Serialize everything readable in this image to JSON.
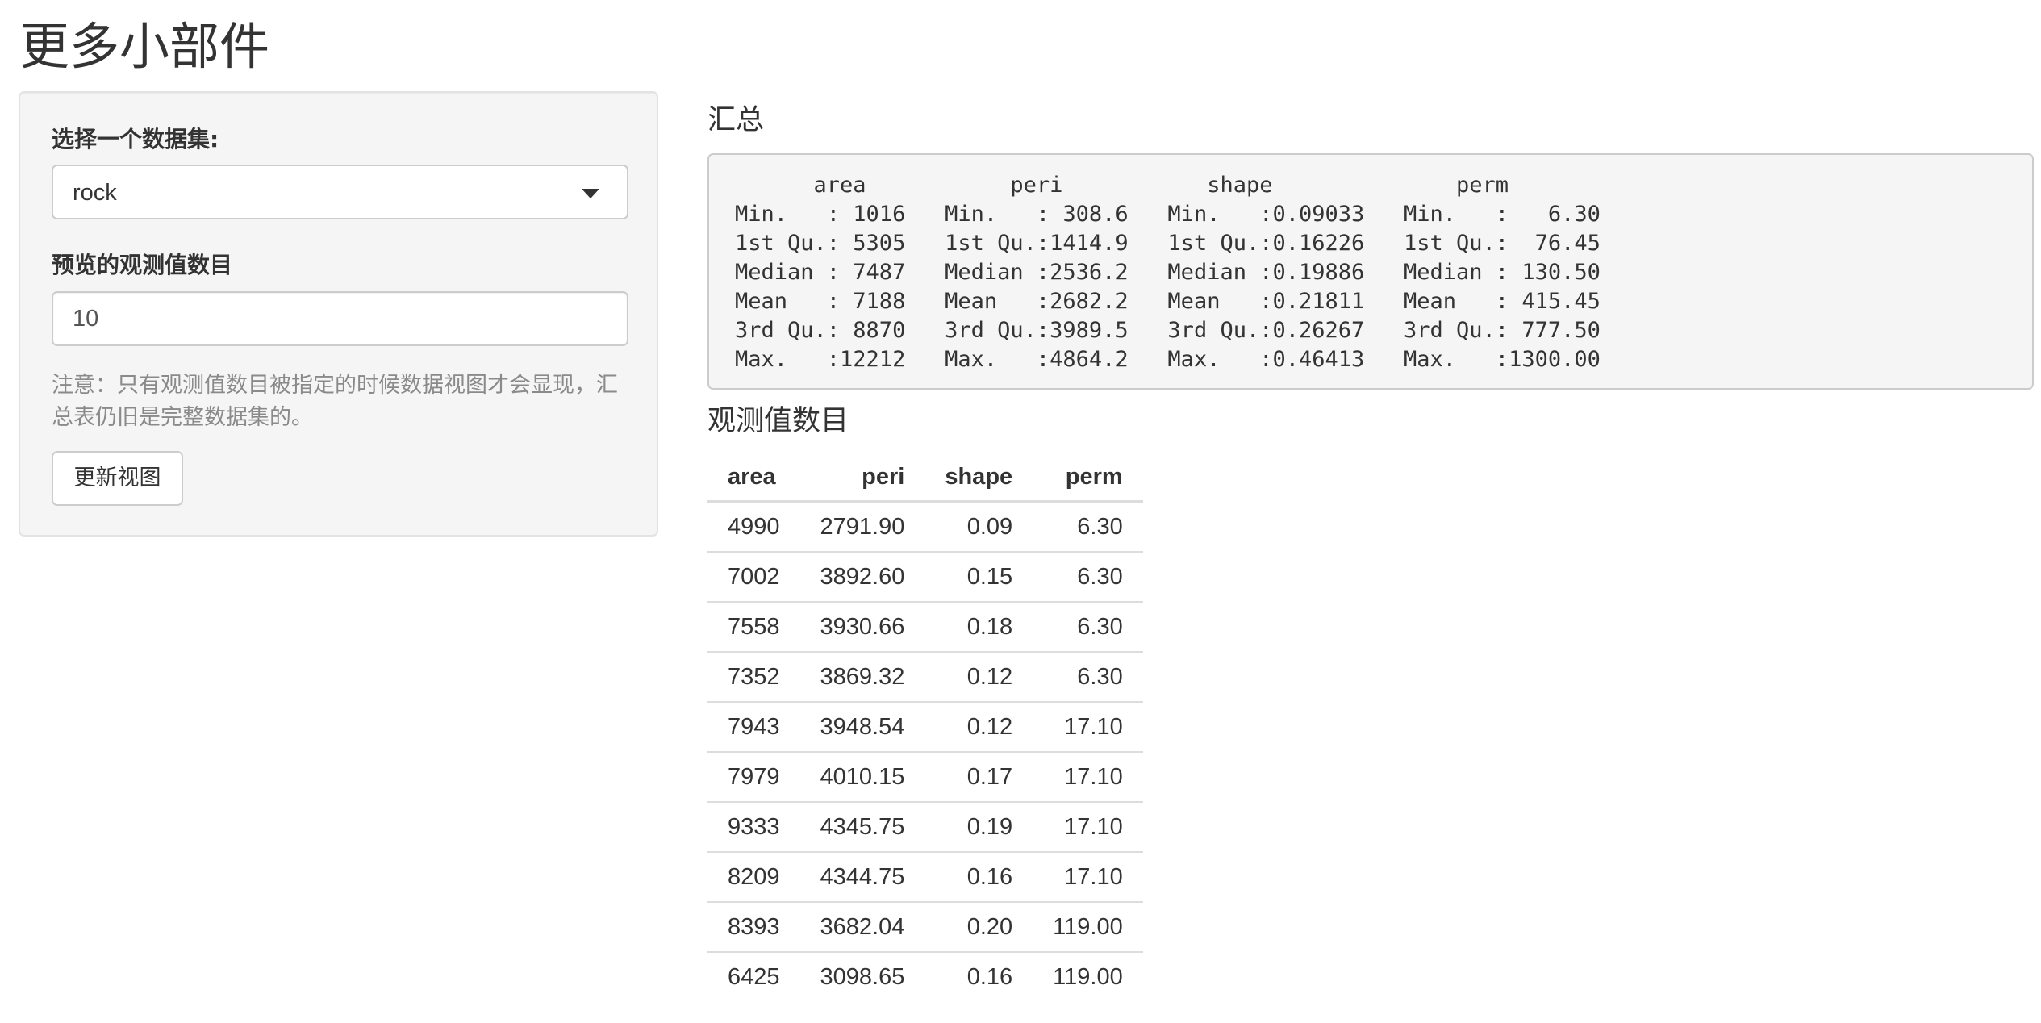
{
  "page": {
    "title": "更多小部件"
  },
  "sidebar": {
    "dataset_label": "选择一个数据集:",
    "dataset_value": "rock",
    "obs_label": "预览的观测值数目",
    "obs_value": "10",
    "help_text": "注意：只有观测值数目被指定的时候数据视图才会显现，汇总表仍旧是完整数据集的。",
    "update_button": "更新视图"
  },
  "summary": {
    "heading": "汇总",
    "lines": [
      "      area           peri           shape              perm       ",
      "Min.   : 1016   Min.   : 308.6   Min.   :0.09033   Min.   :   6.30  ",
      "1st Qu.: 5305   1st Qu.:1414.9   1st Qu.:0.16226   1st Qu.:  76.45  ",
      "Median : 7487   Median :2536.2   Median :0.19886   Median : 130.50  ",
      "Mean   : 7188   Mean   :2682.2   Mean   :0.21811   Mean   : 415.45  ",
      "3rd Qu.: 8870   3rd Qu.:3989.5   3rd Qu.:0.26267   3rd Qu.: 777.50  ",
      "Max.   :12212   Max.   :4864.2   Max.   :0.46413   Max.   :1300.00  "
    ]
  },
  "observations": {
    "heading": "观测值数目",
    "columns": [
      "area",
      "peri",
      "shape",
      "perm"
    ],
    "rows": [
      [
        "4990",
        "2791.90",
        "0.09",
        "6.30"
      ],
      [
        "7002",
        "3892.60",
        "0.15",
        "6.30"
      ],
      [
        "7558",
        "3930.66",
        "0.18",
        "6.30"
      ],
      [
        "7352",
        "3869.32",
        "0.12",
        "6.30"
      ],
      [
        "7943",
        "3948.54",
        "0.12",
        "17.10"
      ],
      [
        "7979",
        "4010.15",
        "0.17",
        "17.10"
      ],
      [
        "9333",
        "4345.75",
        "0.19",
        "17.10"
      ],
      [
        "8209",
        "4344.75",
        "0.16",
        "17.10"
      ],
      [
        "8393",
        "3682.04",
        "0.20",
        "119.00"
      ],
      [
        "6425",
        "3098.65",
        "0.16",
        "119.00"
      ]
    ]
  }
}
